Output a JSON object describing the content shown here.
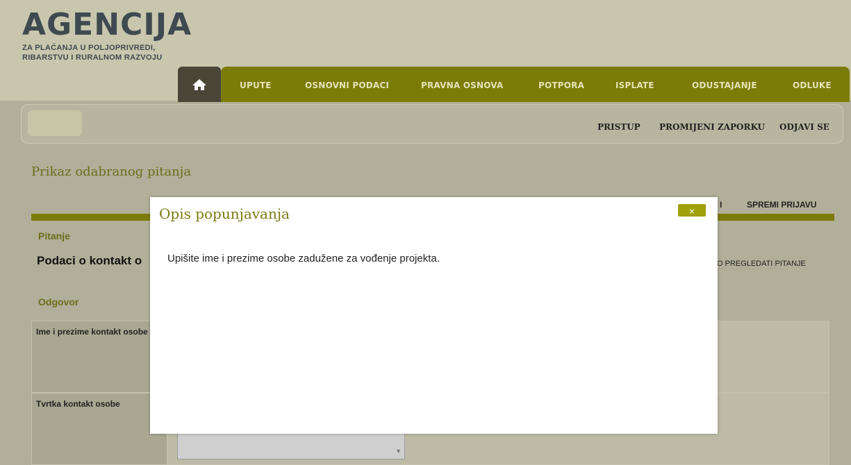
{
  "logo": {
    "title": "AGENCIJA",
    "subtitle_line1": "ZA PLAĆANJA U POLJOPRIVREDI,",
    "subtitle_line2": "RIBARSTVU I RURALNOM RAZVOJU"
  },
  "nav": {
    "home_icon": "home-icon",
    "items": [
      "UPUTE",
      "OSNOVNI PODACI",
      "PRAVNA OSNOVA",
      "POTPORA",
      "ISPLATE",
      "ODUSTAJANJE",
      "ODLUKE"
    ]
  },
  "user_links": [
    "PRISTUP",
    "PROMIJENI ZAPORKU",
    "ODJAVI SE"
  ],
  "page": {
    "title": "Prikaz odabranog pitanja",
    "tab_partial": "I",
    "tab_save": "SPREMI PRIJAVU",
    "section_question": "Pitanje",
    "question_text": "Podaci o kontakt o",
    "side_text": "NO PREGLEDATI PITANJE",
    "section_answer": "Odgovor",
    "rows": [
      {
        "label": "Ime i prezime kontakt osobe"
      },
      {
        "label": "Tvrtka kontakt osobe"
      }
    ]
  },
  "modal": {
    "title": "Opis popunjavanja",
    "close_label": "×",
    "body": "Upišite ime i prezime osobe zadužene za vođenje projekta."
  },
  "colors": {
    "olive": "#7b7b08",
    "dark_tab": "#4a4637",
    "overlay": "#b1af99"
  }
}
